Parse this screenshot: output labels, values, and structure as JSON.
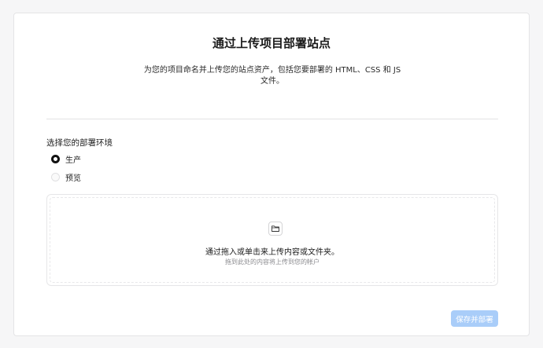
{
  "header": {
    "title": "通过上传项目部署站点",
    "description": "为您的项目命名并上传您的站点资产，包括您要部署的 HTML、CSS 和 JS 文件。"
  },
  "environment": {
    "label": "选择您的部署环境",
    "options": [
      {
        "label": "生产",
        "selected": true
      },
      {
        "label": "预览",
        "selected": false
      }
    ]
  },
  "upload": {
    "icon": "folder-icon",
    "title_prefix": "通过拖入或单击来上传",
    "title_link1": "内容",
    "title_mid": "或",
    "title_link2": "文件夹",
    "title_suffix": "。",
    "subtitle": "拖到此处的内容将上传到您的帐户"
  },
  "actions": {
    "save_label": "保存并部署"
  }
}
